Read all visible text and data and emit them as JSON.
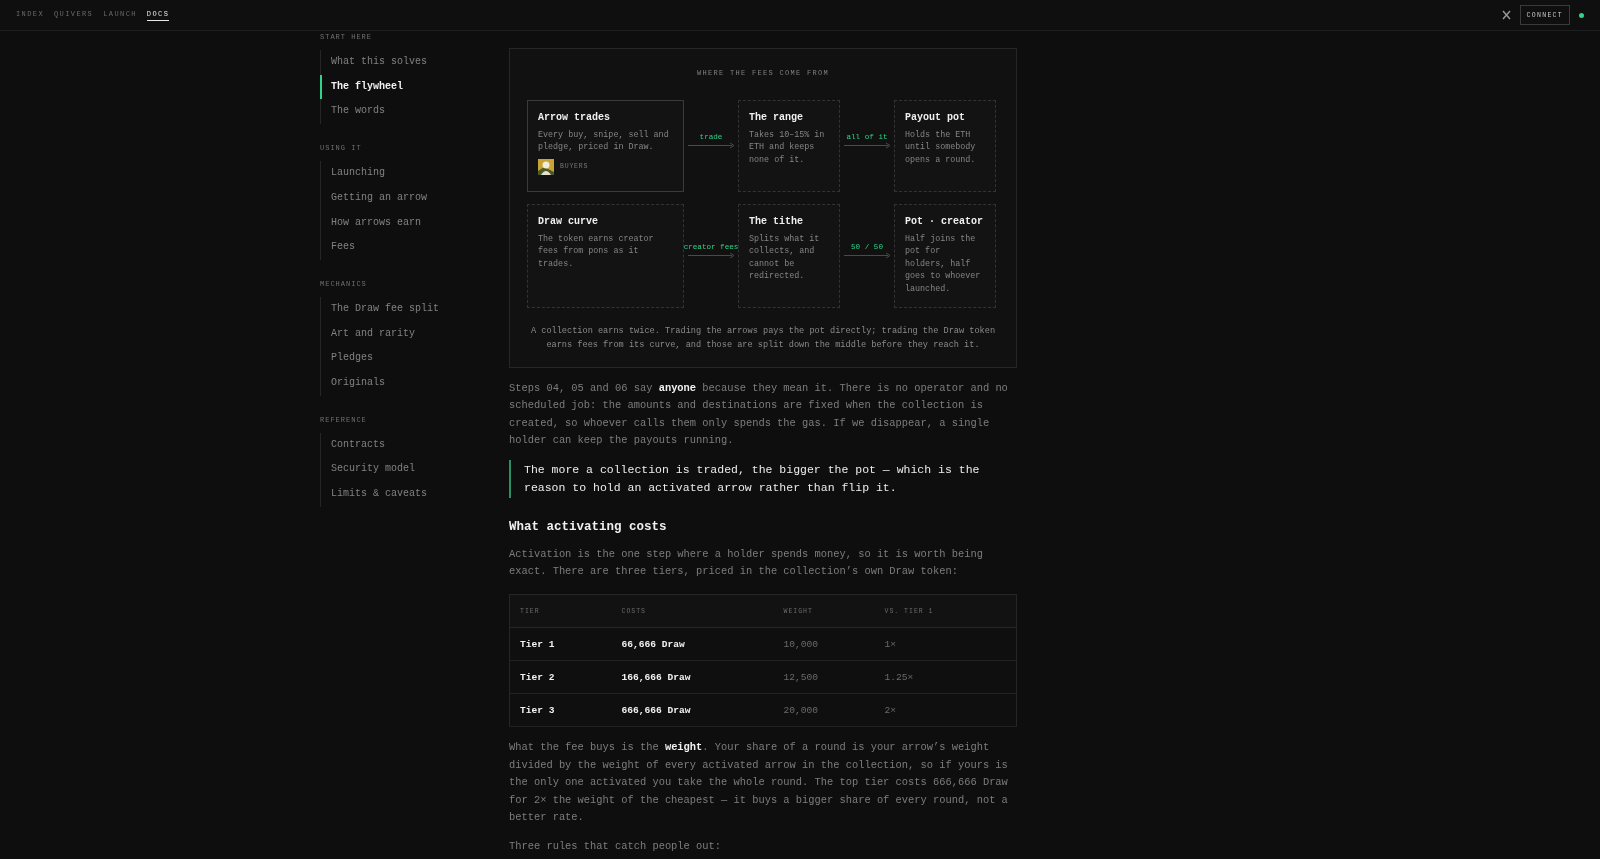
{
  "nav": {
    "items": [
      {
        "label": "INDEX",
        "selected": false
      },
      {
        "label": "QUIVERS",
        "selected": false
      },
      {
        "label": "LAUNCH",
        "selected": false
      },
      {
        "label": "DOCS",
        "selected": true
      }
    ],
    "connect": "CONNECT",
    "connected": true
  },
  "sidebar": {
    "sections": [
      {
        "title": "START HERE",
        "items": [
          {
            "label": "What this solves",
            "selected": false
          },
          {
            "label": "The flywheel",
            "selected": true
          },
          {
            "label": "The words",
            "selected": false
          }
        ]
      },
      {
        "title": "USING IT",
        "items": [
          {
            "label": "Launching",
            "selected": false
          },
          {
            "label": "Getting an arrow",
            "selected": false
          },
          {
            "label": "How arrows earn",
            "selected": false
          },
          {
            "label": "Fees",
            "selected": false
          }
        ]
      },
      {
        "title": "MECHANICS",
        "items": [
          {
            "label": "The Draw fee split",
            "selected": false
          },
          {
            "label": "Art and rarity",
            "selected": false
          },
          {
            "label": "Pledges",
            "selected": false
          },
          {
            "label": "Originals",
            "selected": false
          }
        ]
      },
      {
        "title": "REFERENCE",
        "items": [
          {
            "label": "Contracts",
            "selected": false
          },
          {
            "label": "Security model",
            "selected": false
          },
          {
            "label": "Limits & caveats",
            "selected": false
          }
        ]
      }
    ]
  },
  "diagram": {
    "title": "WHERE THE FEES COME FROM",
    "rows": [
      {
        "nodes": [
          {
            "title": "Arrow trades",
            "text": "Every buy, snipe, sell and pledge, priced in Draw.",
            "dashed": false,
            "tag": "BUYERS"
          },
          {
            "title": "The range",
            "text": "Takes 10–15% in ETH and keeps none of it.",
            "dashed": true
          },
          {
            "title": "Payout pot",
            "text": "Holds the ETH until somebody opens a round.",
            "dashed": true
          }
        ],
        "connectors": [
          "trade",
          "all of it"
        ]
      },
      {
        "nodes": [
          {
            "title": "Draw curve",
            "text": "The token earns creator fees from pons as it trades.",
            "dashed": true
          },
          {
            "title": "The tithe",
            "text": "Splits what it collects, and cannot be redirected.",
            "dashed": true
          },
          {
            "title": "Pot · creator",
            "text": "Half joins the pot for holders, half goes to whoever launched.",
            "dashed": true
          }
        ],
        "connectors": [
          "creator fees",
          "50 / 50"
        ]
      }
    ],
    "caption": "A collection earns twice. Trading the arrows pays the pot directly; trading the Draw token earns fees from its curve, and those are split down the middle before they reach it."
  },
  "article": [
    {
      "kind": "paragraph",
      "text": "Steps 04, 05 and 06 say **anyone** because they mean it. There is no operator and no scheduled job: the amounts and destinations are fixed when the collection is created, so whoever calls them only spends the gas. If we disappear, a single holder can keep the payouts running."
    },
    {
      "kind": "quote",
      "text": "The more a collection is traded, the bigger the pot — which is the reason to hold an activated arrow rather than flip it."
    },
    {
      "kind": "heading",
      "text": "What activating costs"
    },
    {
      "kind": "paragraph",
      "text": "Activation is the one step where a holder spends money, so it is worth being exact. There are three tiers, priced in the collection’s own Draw token:"
    },
    {
      "kind": "table",
      "columns": [
        "TIER",
        "COSTS",
        "WEIGHT",
        "VS. TIER 1"
      ],
      "rows": [
        [
          "Tier 1",
          "66,666 Draw",
          "10,000",
          "1×"
        ],
        [
          "Tier 2",
          "166,666 Draw",
          "12,500",
          "1.25×"
        ],
        [
          "Tier 3",
          "666,666 Draw",
          "20,000",
          "2×"
        ]
      ]
    },
    {
      "kind": "paragraph",
      "text": "What the fee buys is the **weight**. Your share of a round is your arrow’s weight divided by the weight of every activated arrow in the collection, so if yours is the only one activated you take the whole round. The top tier costs 666,666 Draw for 2× the weight of the cheapest — it buys a bigger share of every round, not a better rate."
    },
    {
      "kind": "paragraph",
      "text": "Three rules that catch people out:"
    }
  ]
}
